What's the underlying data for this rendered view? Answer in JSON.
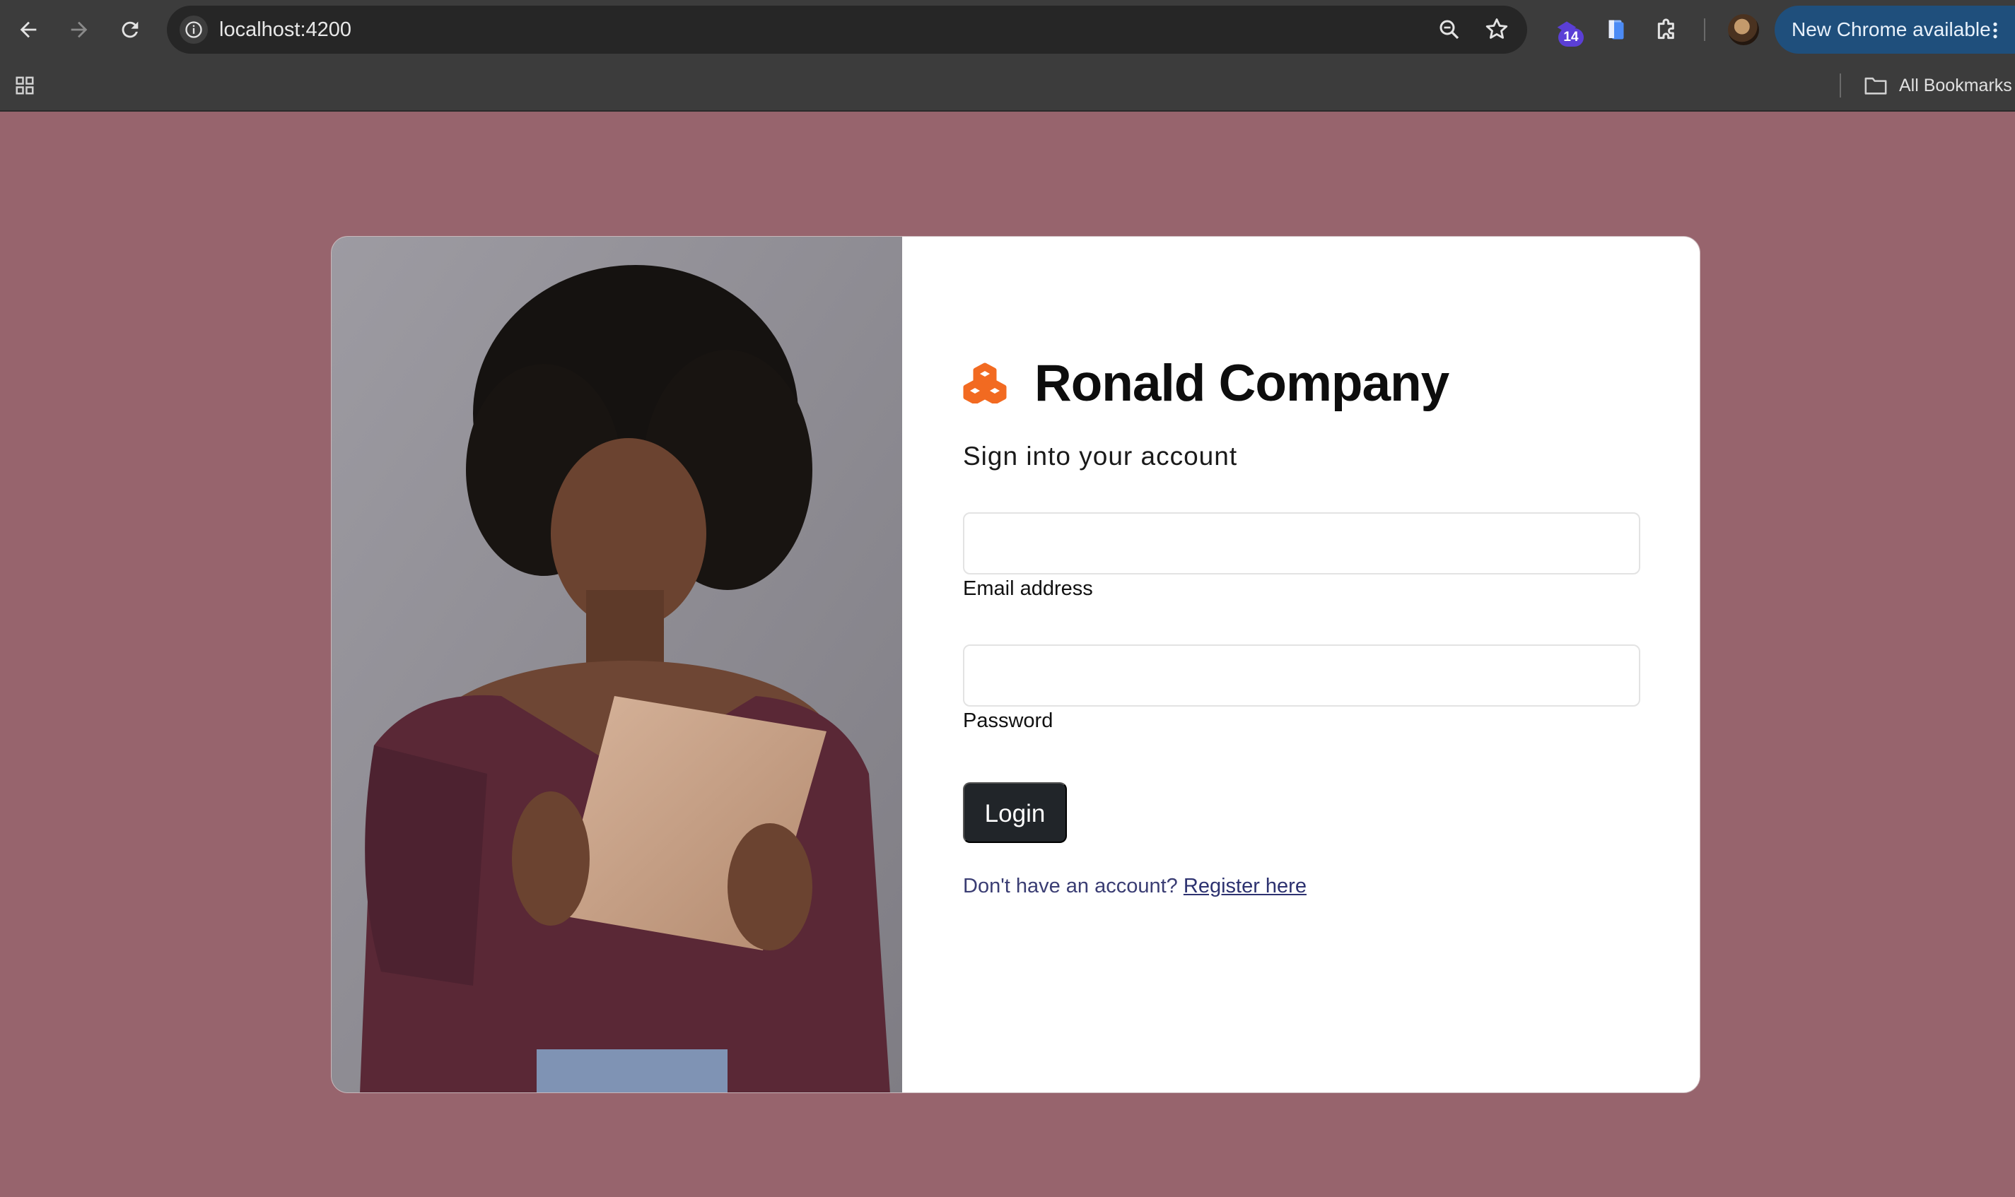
{
  "browser": {
    "url": "localhost:4200",
    "extension_badge": "14",
    "update_label": "New Chrome available",
    "bookmarks_label": "All Bookmarks",
    "icons": [
      "back-arrow-icon",
      "forward-arrow-icon",
      "reload-icon",
      "site-info-icon",
      "zoom-icon",
      "bookmark-star-icon",
      "extension-icon",
      "docs-extension-icon",
      "puzzle-icon",
      "profile-avatar",
      "more-vert-icon",
      "apps-grid-icon",
      "folder-icon"
    ]
  },
  "login": {
    "brand_name": "Ronald Company",
    "brand_icon": "cubes-icon",
    "brand_color": "#f26a21",
    "subtitle": "Sign into your account",
    "email": {
      "label": "Email address",
      "value": ""
    },
    "password": {
      "label": "Password",
      "value": ""
    },
    "login_button": "Login",
    "register_prompt": "Don't have an account?",
    "register_link": "Register here"
  },
  "colors": {
    "page_background": "#97646d",
    "button_background": "#212529"
  }
}
